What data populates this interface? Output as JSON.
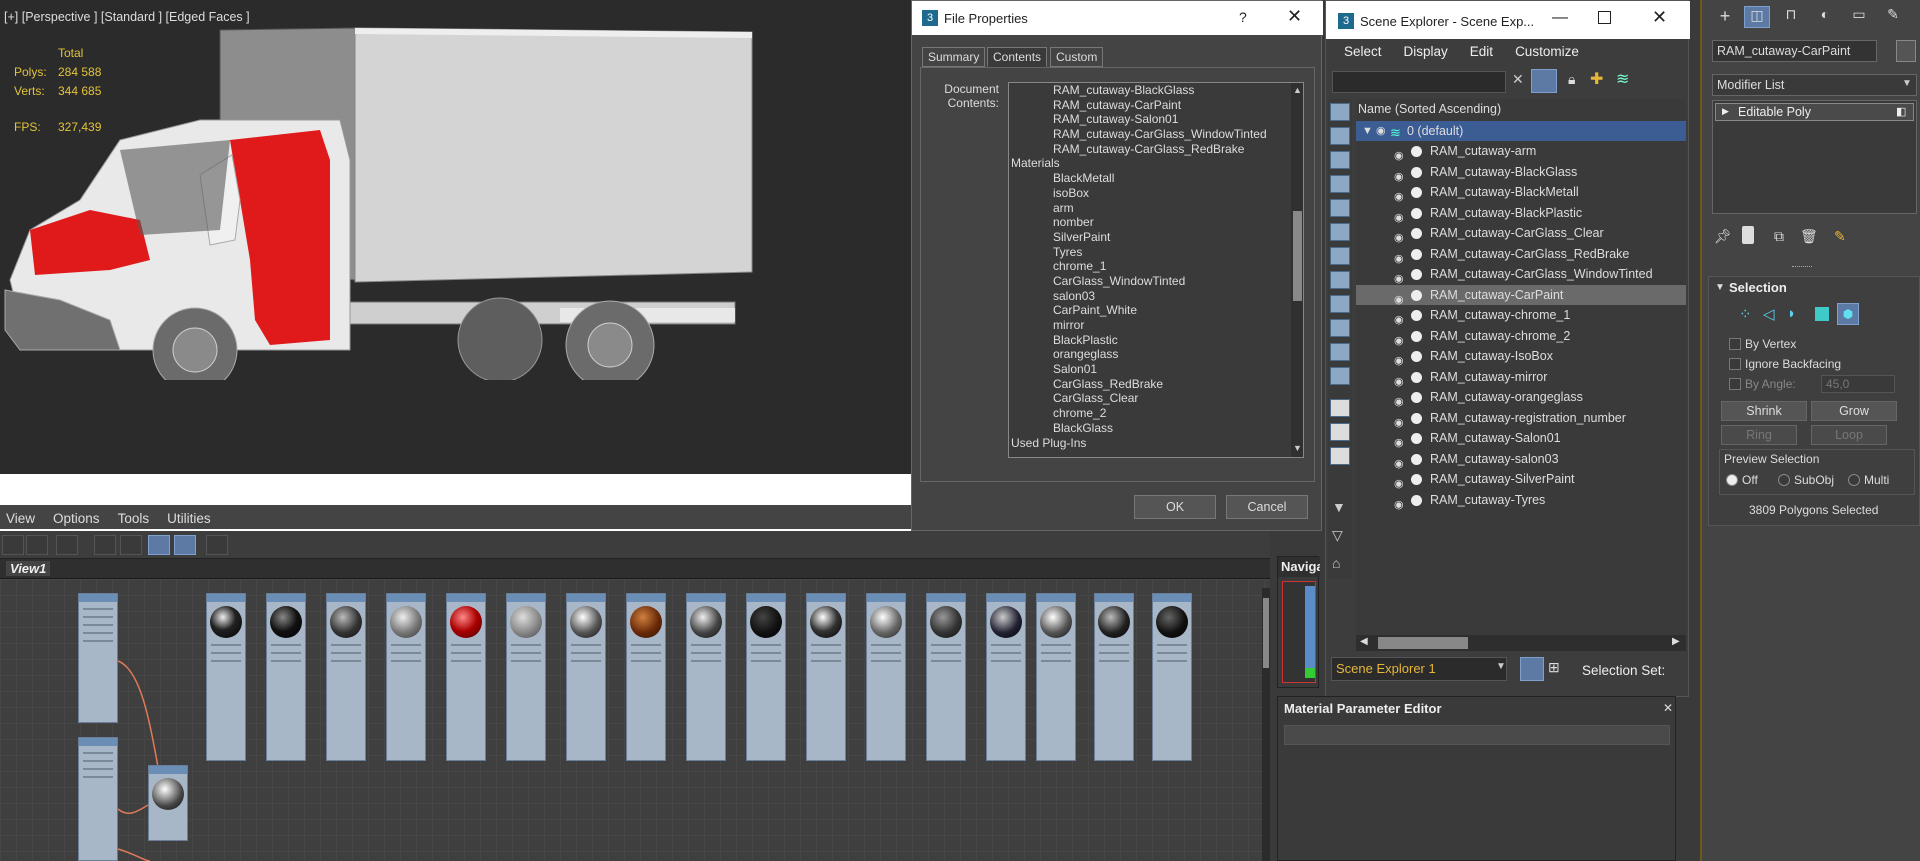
{
  "viewport": {
    "label": "[+] [Perspective ] [Standard ] [Edged Faces ]",
    "stats": {
      "total_label": "Total",
      "polys_label": "Polys:",
      "polys": "284 588",
      "verts_label": "Verts:",
      "verts": "344 685",
      "fps_label": "FPS:",
      "fps": "327,439"
    }
  },
  "slate": {
    "menu": [
      "View",
      "Options",
      "Tools",
      "Utilities"
    ],
    "view_tab": "View1"
  },
  "file_properties": {
    "title": "File Properties",
    "help": "?",
    "tabs": [
      "Summary",
      "Contents",
      "Custom"
    ],
    "selected_tab": "Contents",
    "doc_label": "Document Contents:",
    "contents": [
      {
        "text": "RAM_cutaway-BlackGlass",
        "indent": true
      },
      {
        "text": "RAM_cutaway-CarPaint",
        "indent": true
      },
      {
        "text": "RAM_cutaway-Salon01",
        "indent": true
      },
      {
        "text": "RAM_cutaway-CarGlass_WindowTinted",
        "indent": true
      },
      {
        "text": "RAM_cutaway-CarGlass_RedBrake",
        "indent": true
      },
      {
        "text": "Materials",
        "indent": false
      },
      {
        "text": "BlackMetall",
        "indent": true
      },
      {
        "text": "isoBox",
        "indent": true
      },
      {
        "text": "arm",
        "indent": true
      },
      {
        "text": "nomber",
        "indent": true
      },
      {
        "text": "SilverPaint",
        "indent": true
      },
      {
        "text": "Tyres",
        "indent": true
      },
      {
        "text": "chrome_1",
        "indent": true
      },
      {
        "text": "CarGlass_WindowTinted",
        "indent": true
      },
      {
        "text": "salon03",
        "indent": true
      },
      {
        "text": "CarPaint_White",
        "indent": true
      },
      {
        "text": "mirror",
        "indent": true
      },
      {
        "text": "BlackPlastic",
        "indent": true
      },
      {
        "text": "orangeglass",
        "indent": true
      },
      {
        "text": "Salon01",
        "indent": true
      },
      {
        "text": "CarGlass_RedBrake",
        "indent": true
      },
      {
        "text": "CarGlass_Clear",
        "indent": true
      },
      {
        "text": "chrome_2",
        "indent": true
      },
      {
        "text": "BlackGlass",
        "indent": true
      },
      {
        "text": "Used Plug-Ins",
        "indent": false
      }
    ],
    "ok": "OK",
    "cancel": "Cancel"
  },
  "scene_explorer": {
    "title": "Scene Explorer - Scene Exp...",
    "menu": [
      "Select",
      "Display",
      "Edit",
      "Customize"
    ],
    "column_header": "Name (Sorted Ascending)",
    "layer": "0 (default)",
    "items": [
      "RAM_cutaway-arm",
      "RAM_cutaway-BlackGlass",
      "RAM_cutaway-BlackMetall",
      "RAM_cutaway-BlackPlastic",
      "RAM_cutaway-CarGlass_Clear",
      "RAM_cutaway-CarGlass_RedBrake",
      "RAM_cutaway-CarGlass_WindowTinted",
      "RAM_cutaway-CarPaint",
      "RAM_cutaway-chrome_1",
      "RAM_cutaway-chrome_2",
      "RAM_cutaway-IsoBox",
      "RAM_cutaway-mirror",
      "RAM_cutaway-orangeglass",
      "RAM_cutaway-registration_number",
      "RAM_cutaway-Salon01",
      "RAM_cutaway-salon03",
      "RAM_cutaway-SilverPaint",
      "RAM_cutaway-Tyres"
    ],
    "selected_item": "RAM_cutaway-CarPaint",
    "explorer_name": "Scene Explorer 1",
    "selection_set_label": "Selection Set:"
  },
  "navigator": {
    "label": "Naviga"
  },
  "material_parameter_editor": {
    "title": "Material Parameter Editor"
  },
  "command_panel": {
    "object_name": "RAM_cutaway-CarPaint",
    "modifier_list": "Modifier List",
    "stack_item": "Editable Poly",
    "selection_title": "Selection",
    "by_vertex": "By Vertex",
    "ignore_backfacing": "Ignore Backfacing",
    "by_angle_label": "By Angle:",
    "by_angle_value": "45,0",
    "shrink": "Shrink",
    "grow": "Grow",
    "ring": "Ring",
    "loop": "Loop",
    "preview_selection": "Preview Selection",
    "preview_options": [
      "Off",
      "SubObj",
      "Multi"
    ],
    "status": "3809 Polygons Selected"
  },
  "colors": {
    "accent": "#5c7aa3",
    "selection_highlight": "#3b5d94",
    "stat_yellow": "#e3c33a",
    "truck_red": "#e01a1a"
  }
}
